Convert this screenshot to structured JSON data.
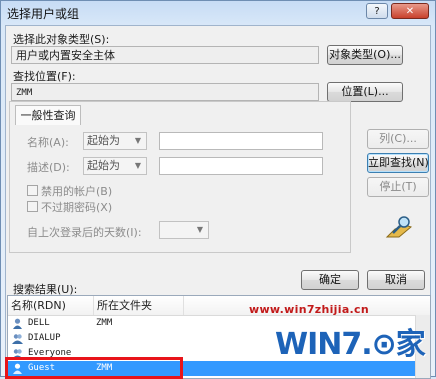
{
  "window": {
    "title": "选择用户或组",
    "controls": [
      "?",
      "✕"
    ]
  },
  "object_type": {
    "label": "选择此对象类型(S):",
    "value": "用户或内置安全主体",
    "button": "对象类型(O)..."
  },
  "location": {
    "label": "查找位置(F):",
    "value": "ZMM",
    "button": "位置(L)..."
  },
  "common_query": {
    "tab": "一般性查询",
    "name_label": "名称(A):",
    "name_mode": "起始为",
    "desc_label": "描述(D):",
    "desc_mode": "起始为",
    "disabled_accounts": "禁用的帐户(B)",
    "no_expire_password": "不过期密码(X)",
    "days_since_logon_label": "自上次登录后的天数(I):"
  },
  "side_buttons": {
    "columns": "列(C)...",
    "find_now": "立即查找(N)",
    "stop": "停止(T)"
  },
  "dialog_buttons": {
    "ok": "确定",
    "cancel": "取消"
  },
  "results": {
    "label": "搜索结果(U):",
    "columns": [
      "名称(RDN)",
      "所在文件夹"
    ],
    "rows": [
      {
        "name": "DELL",
        "folder": "ZMM",
        "selected": false
      },
      {
        "name": "DIALUP",
        "folder": "",
        "selected": false
      },
      {
        "name": "Everyone",
        "folder": "",
        "selected": false
      },
      {
        "name": "Guest",
        "folder": "ZMM",
        "selected": true
      }
    ]
  },
  "watermark": {
    "url": "www.win7zhijia.cn",
    "logo": "WIN7.⊙家"
  },
  "colors": {
    "selection": "#3399ff",
    "highlight": "#e8141a",
    "watermark_blue": "#1d63b8"
  }
}
